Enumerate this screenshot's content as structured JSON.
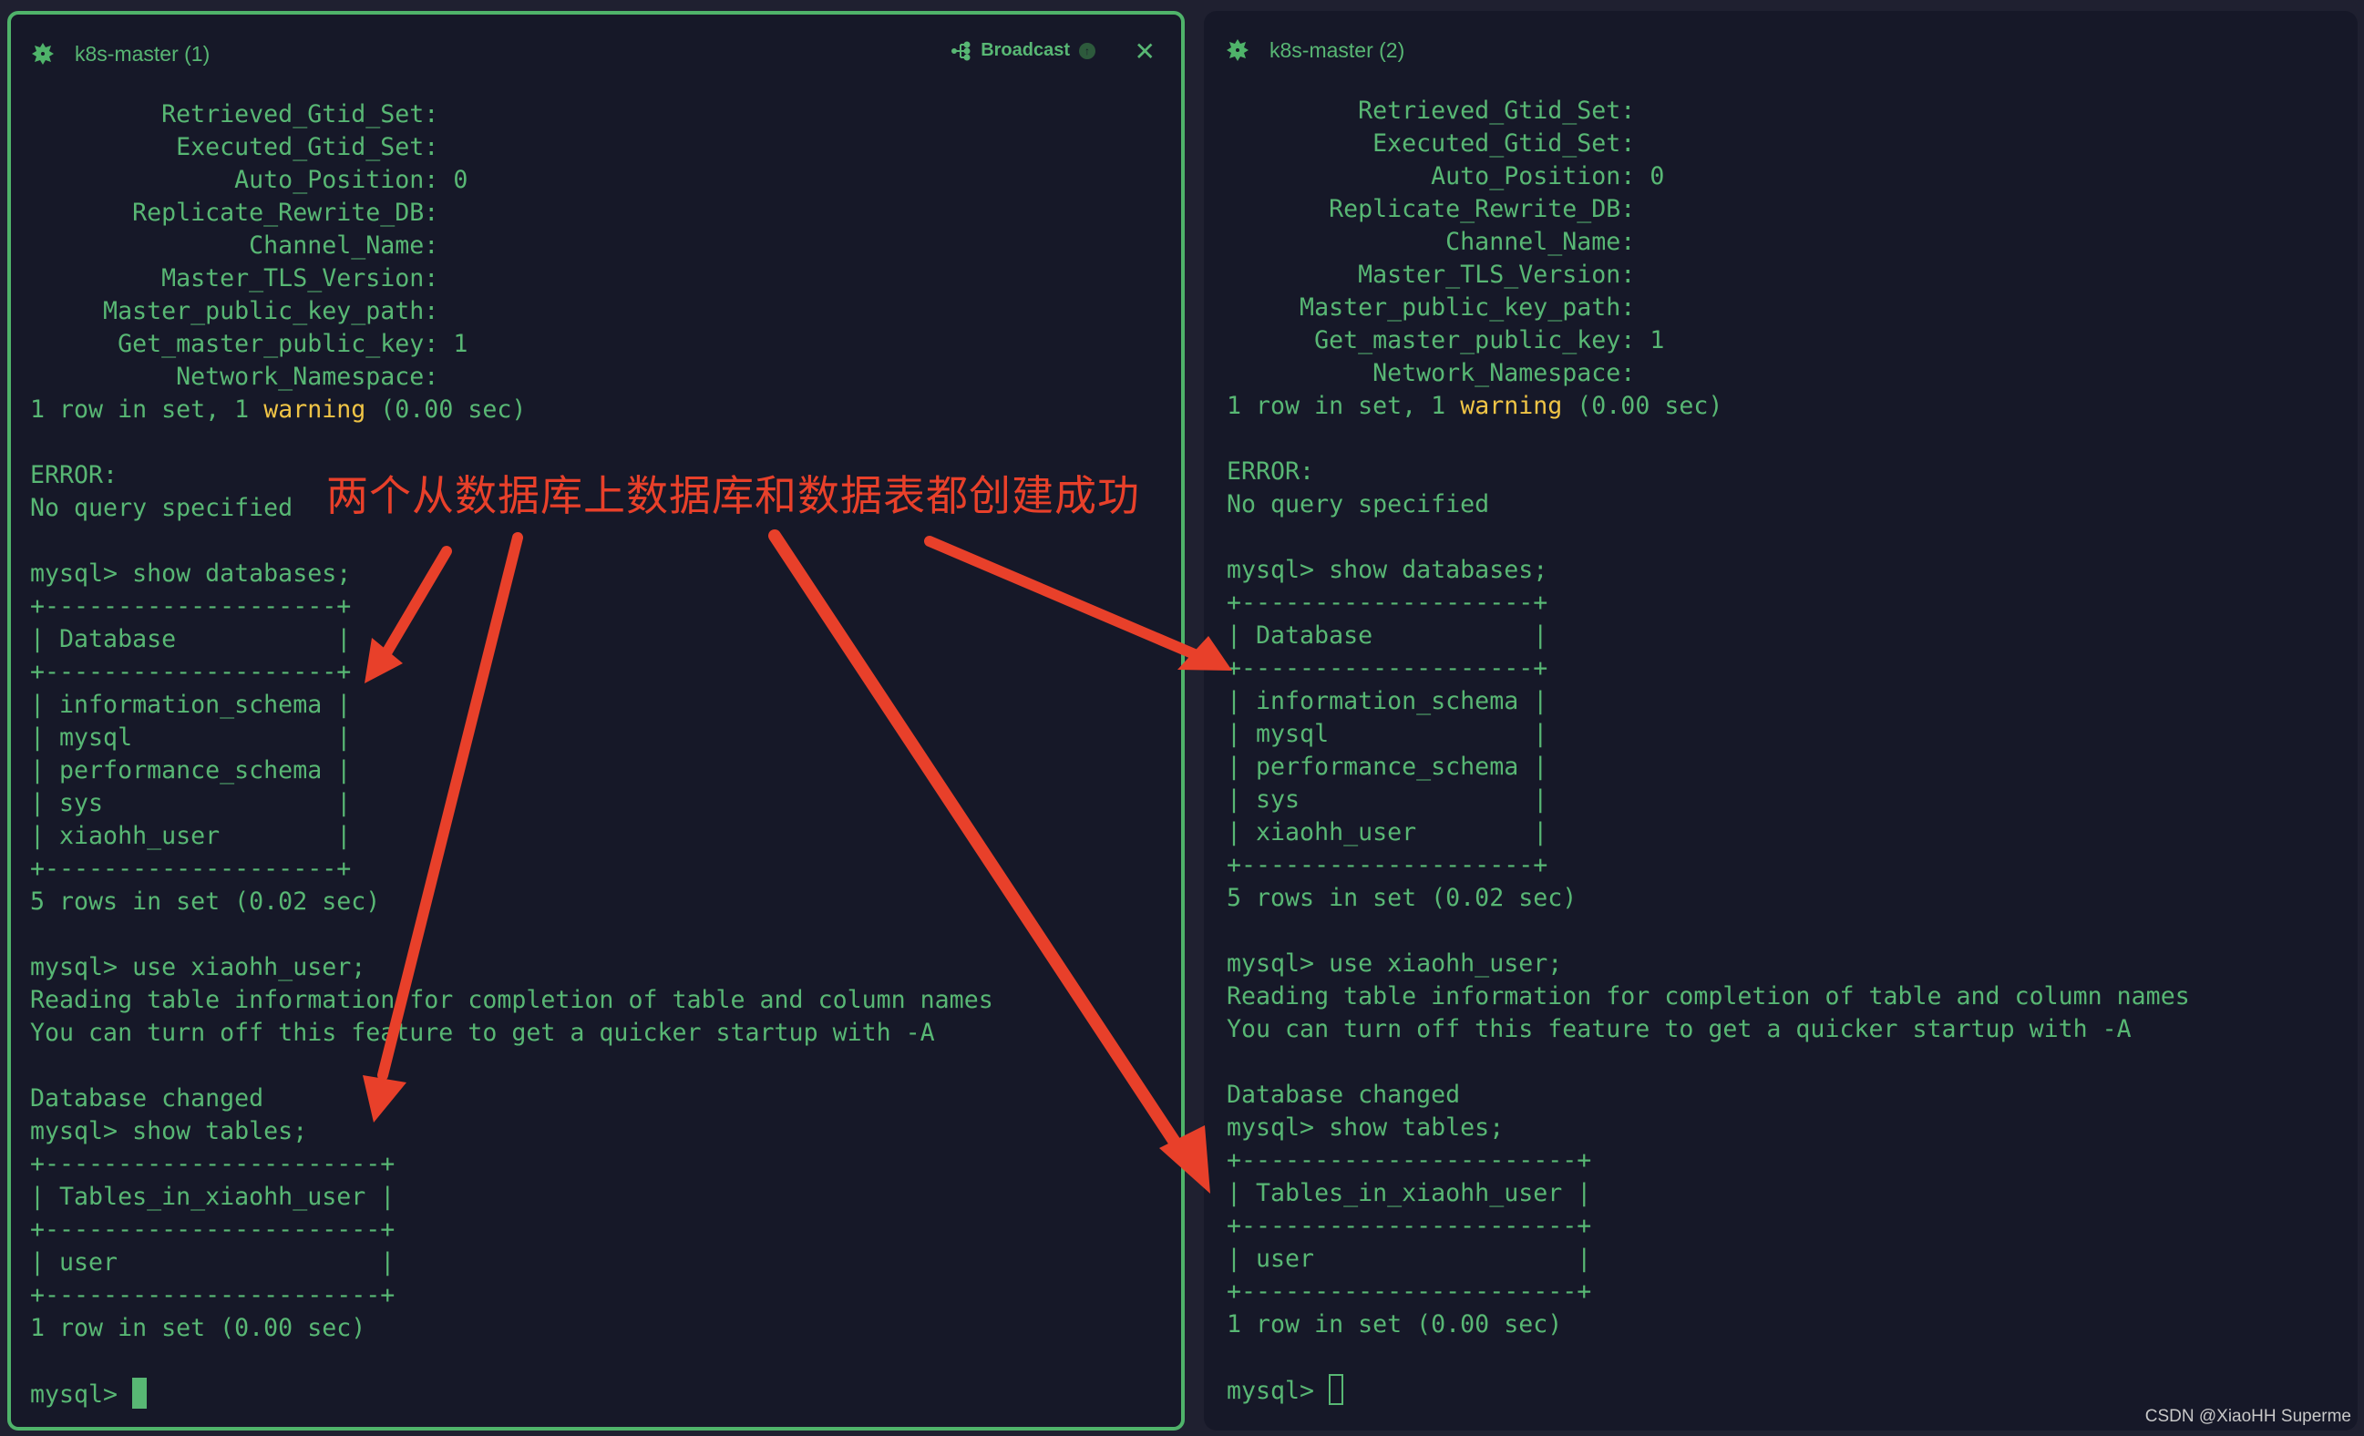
{
  "panes": [
    {
      "title": "k8s-master (1)",
      "icon": "gear-icon",
      "broadcast_label": "Broadcast",
      "active": true,
      "cursor": "solid",
      "lines": [
        "         Retrieved_Gtid_Set:",
        "          Executed_Gtid_Set:",
        "              Auto_Position: 0",
        "       Replicate_Rewrite_DB:",
        "               Channel_Name:",
        "         Master_TLS_Version:",
        "     Master_public_key_path:",
        "      Get_master_public_key: 1",
        "          Network_Namespace:",
        "1 row in set, 1 %WARN% (0.00 sec)",
        "",
        "ERROR:",
        "No query specified",
        "",
        "mysql> show databases;",
        "+--------------------+",
        "| Database           |",
        "+--------------------+",
        "| information_schema |",
        "| mysql              |",
        "| performance_schema |",
        "| sys                |",
        "| xiaohh_user        |",
        "+--------------------+",
        "5 rows in set (0.02 sec)",
        "",
        "mysql> use xiaohh_user;",
        "Reading table information for completion of table and column names",
        "You can turn off this feature to get a quicker startup with -A",
        "",
        "Database changed",
        "mysql> show tables;",
        "+-----------------------+",
        "| Tables_in_xiaohh_user |",
        "+-----------------------+",
        "| user                  |",
        "+-----------------------+",
        "1 row in set (0.00 sec)",
        "",
        "mysql> "
      ]
    },
    {
      "title": "k8s-master (2)",
      "icon": "gear-icon",
      "active": false,
      "cursor": "hollow",
      "lines": [
        "         Retrieved_Gtid_Set:",
        "          Executed_Gtid_Set:",
        "              Auto_Position: 0",
        "       Replicate_Rewrite_DB:",
        "               Channel_Name:",
        "         Master_TLS_Version:",
        "     Master_public_key_path:",
        "      Get_master_public_key: 1",
        "          Network_Namespace:",
        "1 row in set, 1 %WARN% (0.00 sec)",
        "",
        "ERROR:",
        "No query specified",
        "",
        "mysql> show databases;",
        "+--------------------+",
        "| Database           |",
        "+--------------------+",
        "| information_schema |",
        "| mysql              |",
        "| performance_schema |",
        "| sys                |",
        "| xiaohh_user        |",
        "+--------------------+",
        "5 rows in set (0.02 sec)",
        "",
        "mysql> use xiaohh_user;",
        "Reading table information for completion of table and column names",
        "You can turn off this feature to get a quicker startup with -A",
        "",
        "Database changed",
        "mysql> show tables;",
        "+-----------------------+",
        "| Tables_in_xiaohh_user |",
        "+-----------------------+",
        "| user                  |",
        "+-----------------------+",
        "1 row in set (0.00 sec)",
        "",
        "mysql> "
      ]
    }
  ],
  "warning_word": "warning",
  "annotation": {
    "text": "两个从数据库上数据库和数据表都创建成功",
    "color": "#e8402a"
  },
  "colors": {
    "terminal_text": "#58b774",
    "warning": "#f0c446",
    "active_border": "#4fb36a",
    "pane_bg": "#161828",
    "window_bg": "#1f2030"
  },
  "watermark": "CSDN @XiaoHH Superme"
}
